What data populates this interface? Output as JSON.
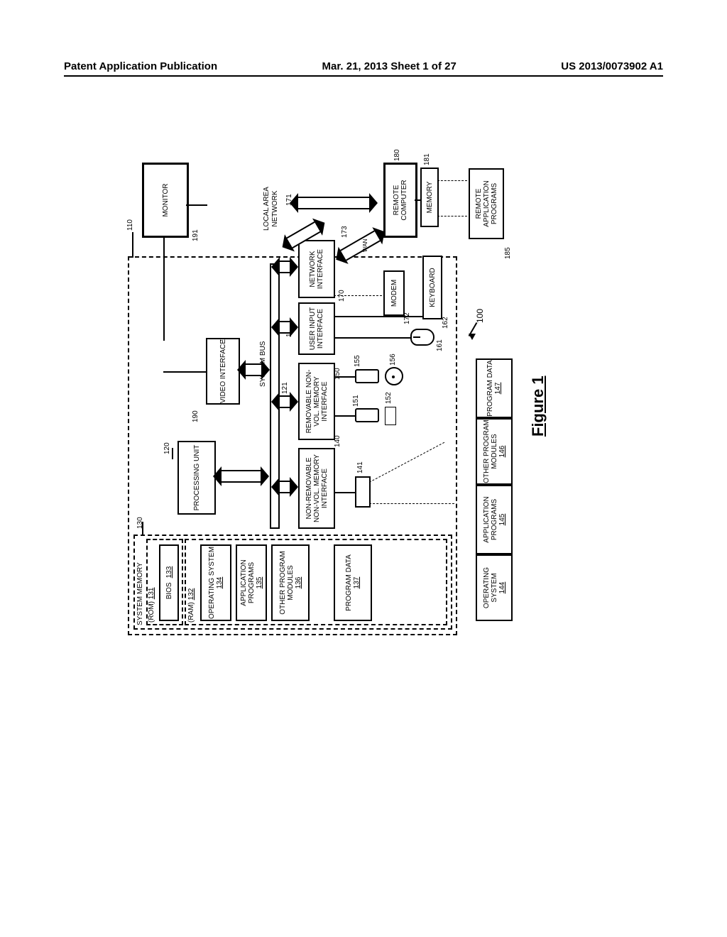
{
  "header": {
    "left": "Patent Application Publication",
    "center": "Mar. 21, 2013  Sheet 1 of 27",
    "right": "US 2013/0073902 A1"
  },
  "figure_caption": "Figure 1",
  "refs": {
    "overall": "100",
    "computer": "110",
    "processing_unit": "120",
    "system_bus": "121",
    "system_memory": "130",
    "rom": "131",
    "ram": "132",
    "bios": "133",
    "os": "134",
    "app_programs": "135",
    "other_modules": "136",
    "program_data": "137",
    "nonrem_iface": "140",
    "hdd": "141",
    "os2": "144",
    "app2": "145",
    "other2": "146",
    "progdata2": "147",
    "rem_iface": "150",
    "floppy": "151",
    "floppy_media": "152",
    "optical": "155",
    "optical_media": "156",
    "user_iface": "160",
    "mouse": "161",
    "keyboard": "162",
    "net_iface": "170",
    "lan": "171",
    "modem": "172",
    "wan": "173",
    "remote_computer": "180",
    "remote_memory": "181",
    "remote_apps": "185",
    "video_iface": "190",
    "monitor": "191"
  },
  "labels": {
    "system_memory": "SYSTEM MEMORY",
    "rom": "(ROM)",
    "bios": "BIOS",
    "ram": "(RAM)",
    "os": "OPERATING\nSYSTEM",
    "app_programs": "APPLICATION\nPROGRAMS",
    "other_modules": "OTHER\nPROGRAM\nMODULES",
    "program_data": "PROGRAM\nDATA",
    "processing_unit": "PROCESSING\nUNIT",
    "video_iface": "VIDEO\nINTERFACE",
    "system_bus": "SYSTEM BUS",
    "nonrem_iface": "NON-REMOVABLE\nNON-VOL. MEMORY\nINTERFACE",
    "rem_iface": "REMOVABLE\nNON-VOL. MEMORY\nINTERFACE",
    "user_iface": "USER\nINPUT\nINTERFACE",
    "net_iface": "NETWORK\nINTERFACE",
    "monitor": "MONITOR",
    "lan": "LOCAL AREA\nNETWORK",
    "wan": "WAN",
    "modem": "MODEM",
    "keyboard": "KEYBOARD",
    "remote_computer": "REMOTE\nCOMPUTER",
    "remote_memory": "MEMORY",
    "remote_apps": "REMOTE\nAPPLICATION\nPROGRAMS",
    "os2": "OPERATING\nSYSTEM",
    "app2": "APPLICATION\nPROGRAMS",
    "other2": "OTHER\nPROGRAM\nMODULES",
    "progdata2": "PROGRAM\nDATA"
  }
}
